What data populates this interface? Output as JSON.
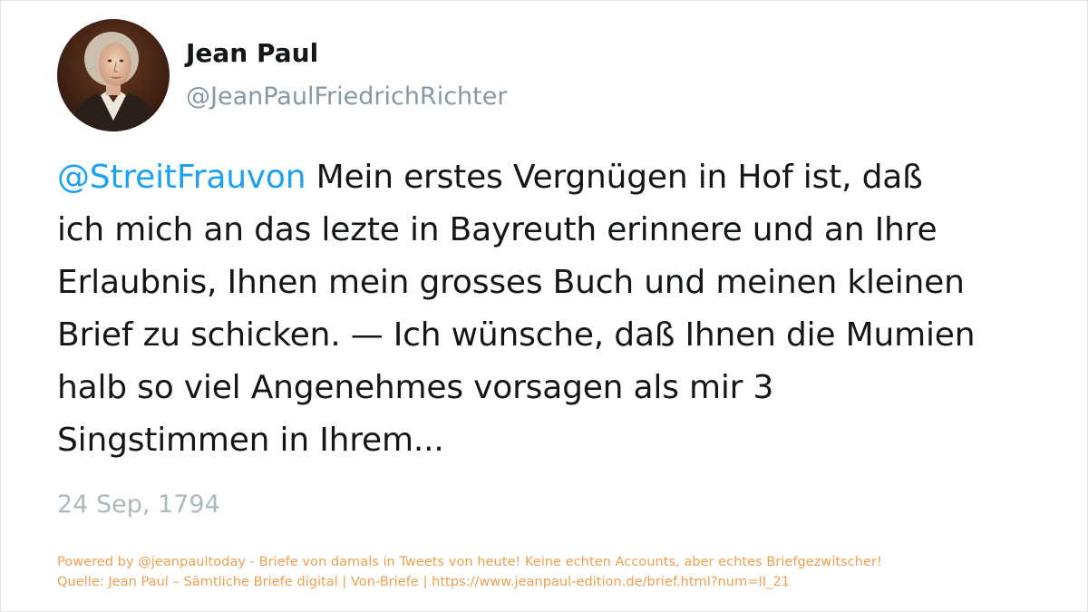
{
  "author": {
    "display_name": "Jean Paul",
    "handle": "@JeanPaulFriedrichRichter",
    "avatar_icon": "portrait-avatar"
  },
  "tweet": {
    "mention": "@StreitFrauvon",
    "body_lines": [
      " Mein erstes Vergnügen in Hof ist, daß",
      "ich mich an das lezte in Bayreuth erinnere und an Ihre",
      "Erlaubnis, Ihnen mein grosses Buch und meinen kleinen",
      "Brief zu schicken. — Ich wünsche, daß Ihnen die Mumien",
      "halb so viel Angenehmes vorsagen als mir 3",
      "Singstimmen in Ihrem..."
    ],
    "date": "24 Sep, 1794"
  },
  "footer": {
    "line1": "Powered by @jeanpaultoday - Briefe von damals in Tweets von heute! Keine echten Accounts, aber echtes Briefgezwitscher!",
    "line2": "Quelle: Jean Paul – Sämtliche Briefe digital | Von-Briefe | https://www.jeanpaul-edition.de/brief.html?num=II_21"
  },
  "colors": {
    "mention": "#1da1f2",
    "text": "#14171a",
    "muted": "#8899a6",
    "date": "#aab8c2",
    "footer": "#f0a050"
  }
}
